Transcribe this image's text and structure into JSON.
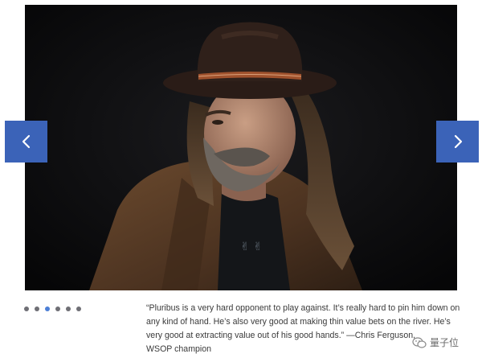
{
  "carousel": {
    "prev_icon": "chevron-left-icon",
    "next_icon": "chevron-right-icon",
    "dots": [
      {
        "active": false
      },
      {
        "active": false
      },
      {
        "active": true
      },
      {
        "active": false
      },
      {
        "active": false
      },
      {
        "active": false
      }
    ]
  },
  "quote": {
    "text": "“Pluribus is a very hard opponent to play against. It’s really hard to pin him down on any kind of hand. He’s also very good at making thin value bets on the river. He’s very good at extracting value out of his good hands.”",
    "attribution": "—Chris Ferguson,",
    "role": "WSOP champion"
  },
  "watermark": {
    "text": "量子位",
    "icon": "wechat-icon"
  },
  "colors": {
    "nav_button": "#3b63b8",
    "dot_active": "#4c7fd6",
    "dot_inactive": "#6f6f75"
  }
}
